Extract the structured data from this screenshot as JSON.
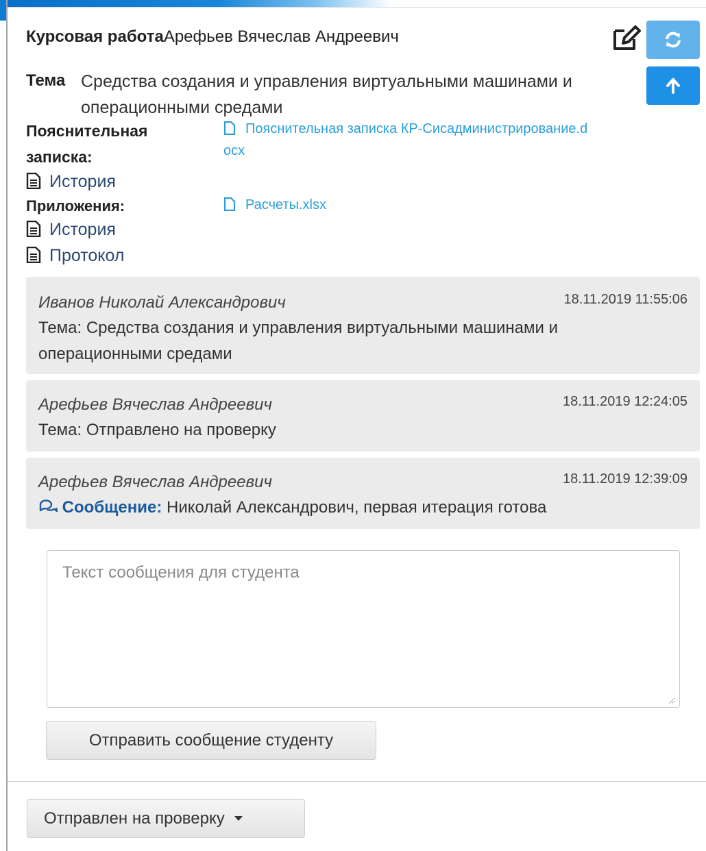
{
  "header": {
    "title_label": "Курсовая работа",
    "student_name": "Арефьев Вячеслав Андреевич",
    "edit_icon": "edit-icon",
    "refresh_icon": "refresh-icon",
    "upload_icon": "arrow-up-icon",
    "accent_color": "#1e90e6"
  },
  "topic": {
    "label": "Тема",
    "value": "Средства создания и управления виртуальными машинами и операционными средами"
  },
  "note": {
    "label_line1": "Пояснительная",
    "label_line2": "записка:",
    "file_part1": "Пояснительная записка КР-Сисадминистрирование.d",
    "file_part2": "ocx",
    "history": "История"
  },
  "attachments": {
    "label": "Приложения:",
    "file": "Расчеты.xlsx",
    "history": "История",
    "protocol": "Протокол"
  },
  "messages": [
    {
      "author": "Иванов Николай Александрович",
      "time": "18.11.2019 11:55:06",
      "line1": "Тема: Средства создания и управления виртуальными машинами и",
      "line2": "операционными средами"
    },
    {
      "author": "Арефьев Вячеслав Андреевич",
      "time": "18.11.2019 12:24:05",
      "line1": "Тема: Отправлено на проверку"
    },
    {
      "author": "Арефьев Вячеслав Андреевич",
      "time": "18.11.2019 12:39:09",
      "label": "Сообщение:",
      "text": "Николай Александрович, первая итерация готова"
    }
  ],
  "composer": {
    "placeholder": "Текст сообщения для студента",
    "send_label": "Отправить сообщение студенту"
  },
  "status": {
    "selected": "Отправлен на проверку"
  }
}
